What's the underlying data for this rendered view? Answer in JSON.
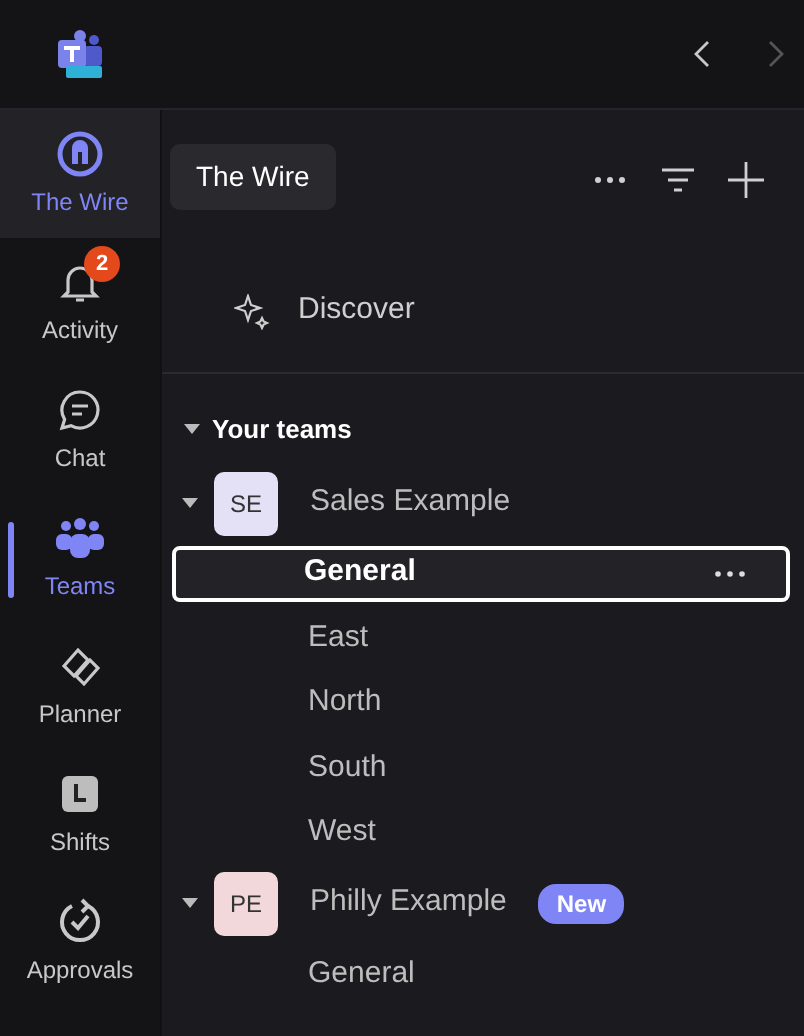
{
  "nav": {
    "back": {
      "disabled": false
    },
    "forward": {
      "disabled": true
    }
  },
  "rail": [
    {
      "label": "The Wire",
      "selected": false,
      "hovered": true
    },
    {
      "label": "Activity",
      "selected": false,
      "hovered": false,
      "badge": "2"
    },
    {
      "label": "Chat",
      "selected": false,
      "hovered": false
    },
    {
      "label": "Teams",
      "selected": true,
      "hovered": false
    },
    {
      "label": "Planner",
      "selected": false,
      "hovered": false
    },
    {
      "label": "Shifts",
      "selected": false,
      "hovered": false
    },
    {
      "label": "Approvals",
      "selected": false,
      "hovered": false
    }
  ],
  "tooltip": "The Wire",
  "discover": "Discover",
  "section": {
    "label": "Your teams",
    "expanded": true
  },
  "teams": [
    {
      "initials": "SE",
      "name": "Sales Example",
      "color": "#e4e0f6",
      "expanded": true,
      "channels": [
        {
          "name": "General",
          "selected": true
        },
        {
          "name": "East",
          "selected": false
        },
        {
          "name": "North",
          "selected": false
        },
        {
          "name": "South",
          "selected": false
        },
        {
          "name": "West",
          "selected": false
        }
      ]
    },
    {
      "initials": "PE",
      "name": "Philly Example",
      "color": "#f2d8da",
      "expanded": true,
      "badge": "New",
      "channels": [
        {
          "name": "General",
          "selected": false
        }
      ]
    }
  ]
}
